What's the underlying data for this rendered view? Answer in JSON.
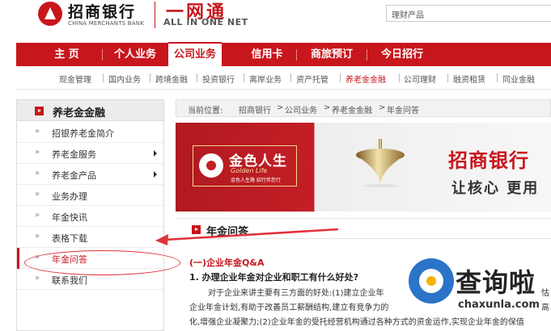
{
  "header": {
    "bank_name_cn": "招商银行",
    "bank_name_en": "CHINA MERCHANTS BANK",
    "portal_name": "一网通",
    "portal_slogan": "ALL IN ONE NET",
    "search_value": "理财产品",
    "logo_icon": "cmb-logo-icon"
  },
  "main_nav": [
    {
      "label": "主 页"
    },
    {
      "label": "个人业务"
    },
    {
      "label": "公司业务",
      "active": true
    },
    {
      "label": "信用卡"
    },
    {
      "label": "商旅预订"
    },
    {
      "label": "今日招行"
    }
  ],
  "sub_nav": [
    {
      "label": "现金管理"
    },
    {
      "label": "国内业务"
    },
    {
      "label": "跨境金融"
    },
    {
      "label": "投资银行"
    },
    {
      "label": "离岸业务"
    },
    {
      "label": "资产托管"
    },
    {
      "label": "养老金金融",
      "active": true
    },
    {
      "label": "公司理财"
    },
    {
      "label": "融资租赁"
    },
    {
      "label": "同业金融"
    }
  ],
  "sidebar": {
    "title": "养老金金融",
    "items": [
      {
        "label": "招银养老金简介",
        "mark": "»"
      },
      {
        "label": "养老金服务",
        "mark": "»",
        "has_submenu": true
      },
      {
        "label": "养老金产品",
        "mark": "»",
        "has_submenu": true
      },
      {
        "label": "业务办理",
        "mark": "»"
      },
      {
        "label": "年金快讯",
        "mark": "»"
      },
      {
        "label": "表格下载",
        "mark": "»"
      },
      {
        "label": "年金问答",
        "mark": "»",
        "active": true
      },
      {
        "label": "联系我们",
        "mark": "»"
      }
    ]
  },
  "breadcrumb": {
    "prefix": "当前位置:",
    "items": [
      "招商银行",
      ">",
      "公司业务",
      ">",
      "养老金金融",
      ">",
      "年金问答"
    ]
  },
  "banner": {
    "golden_life_cn": "金色人生",
    "golden_life_en": "Golden Life",
    "golden_life_sub": "金色人生路  招行伴您行",
    "bank_name": "招商银行",
    "slogan": "让核心 更用"
  },
  "section": {
    "title": "年金问答"
  },
  "content": {
    "heading": "(一)企业年金Q&A",
    "question": "1.  办理企业年金对企业和职工有什么好处?",
    "lines": [
      "对于企业来讲主要有三方面的好处:(1)建立企业年",
      "企业年金计划,有助于改善员工薪酬结构,建立有竞争力的",
      "化,增强企业凝聚力;(2)企业年金的受托经营机构通过各种方式的资金运作,实现企业年金的保值"
    ],
    "right_fragments": [
      "怙",
      "高"
    ]
  },
  "watermark": {
    "name": "查询啦",
    "url": "chaxunla.com"
  },
  "colors": {
    "brand_red": "#c8161d",
    "annotation_red": "#e0313a"
  }
}
